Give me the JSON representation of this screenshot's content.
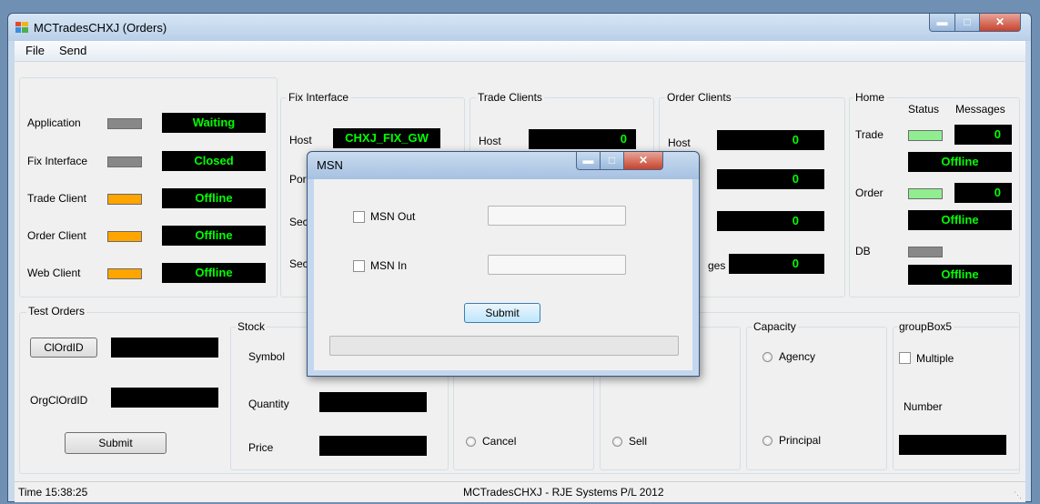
{
  "window": {
    "title": "MCTradesCHXJ (Orders)"
  },
  "menu": {
    "file": "File",
    "send": "Send"
  },
  "status_panel": {
    "rows": [
      {
        "label": "Application",
        "value": "Waiting"
      },
      {
        "label": "Fix Interface",
        "value": "Closed"
      },
      {
        "label": "Trade Client",
        "value": "Offline"
      },
      {
        "label": "Order Client",
        "value": "Offline"
      },
      {
        "label": "Web Client",
        "value": "Offline"
      }
    ]
  },
  "fix_interface": {
    "title": "Fix Interface",
    "host_label": "Host",
    "host_value": "CHXJ_FIX_GW",
    "port_label": "Por",
    "sec1_label": "Sec",
    "sec2_label": "Sec"
  },
  "trade_clients": {
    "title": "Trade Clients",
    "host_label": "Host",
    "host_value": "0"
  },
  "order_clients": {
    "title": "Order Clients",
    "host_label": "Host",
    "host_value": "0",
    "row2_value": "0",
    "row3_value": "0",
    "messages_label": "ges",
    "messages_value": "0"
  },
  "home": {
    "title": "Home",
    "status_header": "Status",
    "messages_header": "Messages",
    "trade_label": "Trade",
    "trade_messages": "0",
    "trade_state": "Offline",
    "order_label": "Order",
    "order_messages": "0",
    "order_state": "Offline",
    "db_label": "DB",
    "db_state": "Offline"
  },
  "test_orders": {
    "title": "Test Orders",
    "clordid_button": "ClOrdID",
    "orgclordid_label": "OrgClOrdID",
    "submit_button": "Submit"
  },
  "stock": {
    "title": "Stock",
    "symbol_label": "Symbol",
    "quantity_label": "Quantity",
    "price_label": "Price"
  },
  "action": {
    "cancel_label": "Cancel"
  },
  "side": {
    "sell_label": "Sell"
  },
  "capacity": {
    "title": "Capacity",
    "agency_label": "Agency",
    "principal_label": "Principal"
  },
  "groupbox5": {
    "title": "groupBox5",
    "multiple_label": "Multiple",
    "number_label": "Number"
  },
  "statusbar": {
    "time": "Time  15:38:25",
    "caption": "MCTradesCHXJ - RJE Systems P/L 2012"
  },
  "dialog": {
    "title": "MSN",
    "msn_out_label": "MSN Out",
    "msn_in_label": "MSN In",
    "submit_button": "Submit",
    "msn_out_value": "",
    "msn_in_value": ""
  },
  "colors": {
    "display_bg": "#000000",
    "display_text": "#00ff00",
    "lamp_orange": "#ffa500",
    "lamp_gray": "#888888",
    "lamp_green": "#90ee90"
  }
}
